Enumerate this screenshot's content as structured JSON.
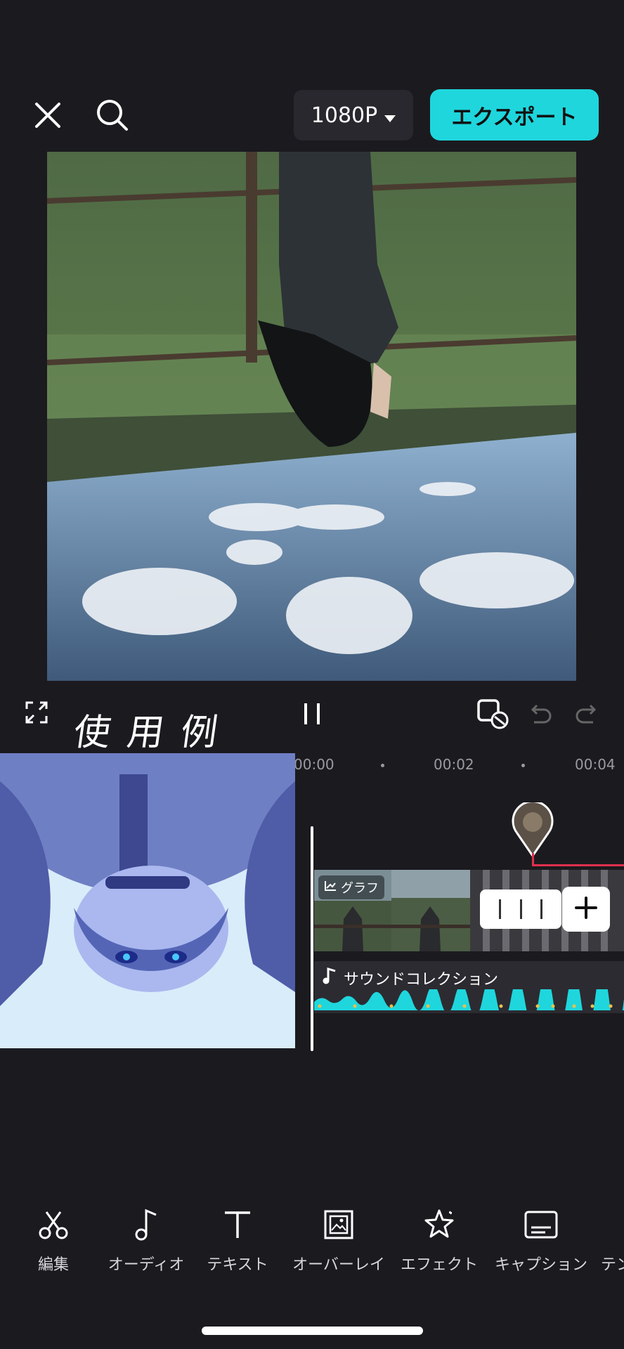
{
  "top_bar": {
    "close_icon": "close-icon",
    "search_icon": "search-icon",
    "resolution": "1080P",
    "export_label": "エクスポート"
  },
  "controls": {
    "handwriting_text": "使用例",
    "icons": [
      "fullscreen-icon",
      "pause-icon",
      "keyframe-icon",
      "undo-icon",
      "redo-icon"
    ]
  },
  "timeline": {
    "timecodes": [
      "00:00",
      "00:02",
      "00:04"
    ],
    "clip_label": "グラフ",
    "audio_label": "サウンドコレクション",
    "colors": {
      "audio_wave": "#1fd6dd",
      "accent": "#1fd6dd",
      "marker_line": "#e0304e"
    }
  },
  "toolbar": {
    "items": [
      {
        "label": "編集",
        "icon": "scissors-icon"
      },
      {
        "label": "オーディオ",
        "icon": "music-note-icon"
      },
      {
        "label": "テキスト",
        "icon": "text-icon"
      },
      {
        "label": "オーバーレイ",
        "icon": "overlay-icon"
      },
      {
        "label": "エフェクト",
        "icon": "effect-star-icon"
      },
      {
        "label": "キャプション",
        "icon": "caption-icon"
      },
      {
        "label": "テン",
        "icon": "template-icon"
      }
    ]
  }
}
